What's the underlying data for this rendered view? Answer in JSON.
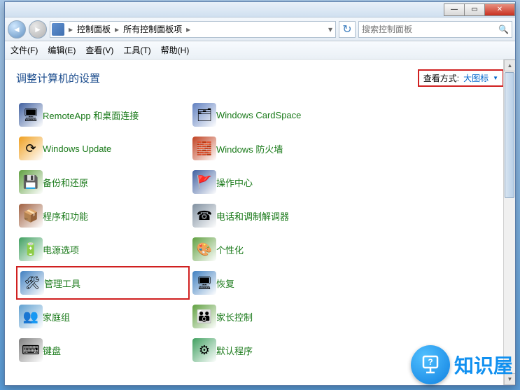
{
  "titlebar": {
    "min": "—",
    "max": "▭",
    "close": "✕"
  },
  "nav": {
    "breadcrumb": [
      "控制面板",
      "所有控制面板项"
    ],
    "search_placeholder": "搜索控制面板"
  },
  "menu": {
    "file": "文件(F)",
    "edit": "编辑(E)",
    "view": "查看(V)",
    "tools": "工具(T)",
    "help": "帮助(H)"
  },
  "header": {
    "title": "调整计算机的设置",
    "viewby_label": "查看方式:",
    "viewby_value": "大图标"
  },
  "items_left": [
    {
      "label": "RemoteApp 和桌面连接",
      "name": "remoteapp",
      "icon_bg": "#4060a0",
      "glyph": "🖥"
    },
    {
      "label": "Windows Update",
      "name": "windows-update",
      "icon_bg": "#f0a020",
      "glyph": "⟳"
    },
    {
      "label": "备份和还原",
      "name": "backup-restore",
      "icon_bg": "#60a040",
      "glyph": "💾"
    },
    {
      "label": "程序和功能",
      "name": "programs-features",
      "icon_bg": "#a06040",
      "glyph": "📦"
    },
    {
      "label": "电源选项",
      "name": "power-options",
      "icon_bg": "#40a060",
      "glyph": "🔋"
    },
    {
      "label": "管理工具",
      "name": "admin-tools",
      "icon_bg": "#4080c0",
      "glyph": "🛠",
      "highlighted": true
    },
    {
      "label": "家庭组",
      "name": "homegroup",
      "icon_bg": "#60a0d0",
      "glyph": "👥"
    },
    {
      "label": "键盘",
      "name": "keyboard",
      "icon_bg": "#808080",
      "glyph": "⌨"
    }
  ],
  "items_right": [
    {
      "label": "Windows CardSpace",
      "name": "cardspace",
      "icon_bg": "#6080c0",
      "glyph": "🗂"
    },
    {
      "label": "Windows 防火墙",
      "name": "firewall",
      "icon_bg": "#c04020",
      "glyph": "🧱"
    },
    {
      "label": "操作中心",
      "name": "action-center",
      "icon_bg": "#4060a0",
      "glyph": "🚩"
    },
    {
      "label": "电话和调制解调器",
      "name": "phone-modem",
      "icon_bg": "#8090a0",
      "glyph": "☎"
    },
    {
      "label": "个性化",
      "name": "personalization",
      "icon_bg": "#60a040",
      "glyph": "🎨"
    },
    {
      "label": "恢复",
      "name": "recovery",
      "icon_bg": "#4080c0",
      "glyph": "🖥"
    },
    {
      "label": "家长控制",
      "name": "parental-controls",
      "icon_bg": "#60a040",
      "glyph": "👪"
    },
    {
      "label": "默认程序",
      "name": "default-programs",
      "icon_bg": "#40a060",
      "glyph": "⚙"
    }
  ],
  "watermark": {
    "text": "知识屋"
  }
}
